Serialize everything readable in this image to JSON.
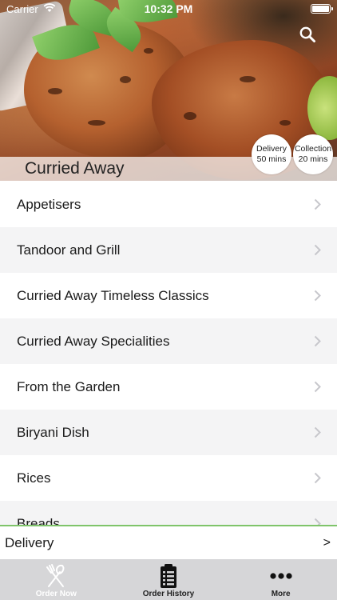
{
  "status_bar": {
    "carrier": "Carrier",
    "time": "10:32 PM"
  },
  "header": {
    "restaurant_name": "Curried Away",
    "search_icon": "search-icon",
    "delivery_badge": {
      "label": "Delivery",
      "time": "50 mins"
    },
    "collection_badge": {
      "label": "Collection",
      "time": "20 mins"
    }
  },
  "categories": [
    {
      "label": "Appetisers"
    },
    {
      "label": "Tandoor and Grill"
    },
    {
      "label": "Curried Away Timeless Classics"
    },
    {
      "label": "Curried Away Specialities"
    },
    {
      "label": "From the Garden"
    },
    {
      "label": "Biryani Dish"
    },
    {
      "label": "Rices"
    },
    {
      "label": "Breads"
    }
  ],
  "delivery_bar": {
    "label": "Delivery",
    "arrow": ">"
  },
  "tab_bar": {
    "tabs": [
      {
        "label": "Order Now",
        "icon": "fork-knife-icon",
        "active": true
      },
      {
        "label": "Order History",
        "icon": "clipboard-list-icon",
        "active": false
      },
      {
        "label": "More",
        "icon": "more-dots-icon",
        "active": false
      }
    ]
  },
  "colors": {
    "accent_green": "#7fc46a",
    "tab_bar_bg": "#d6d6d8",
    "row_alt_bg": "#f4f4f5"
  }
}
